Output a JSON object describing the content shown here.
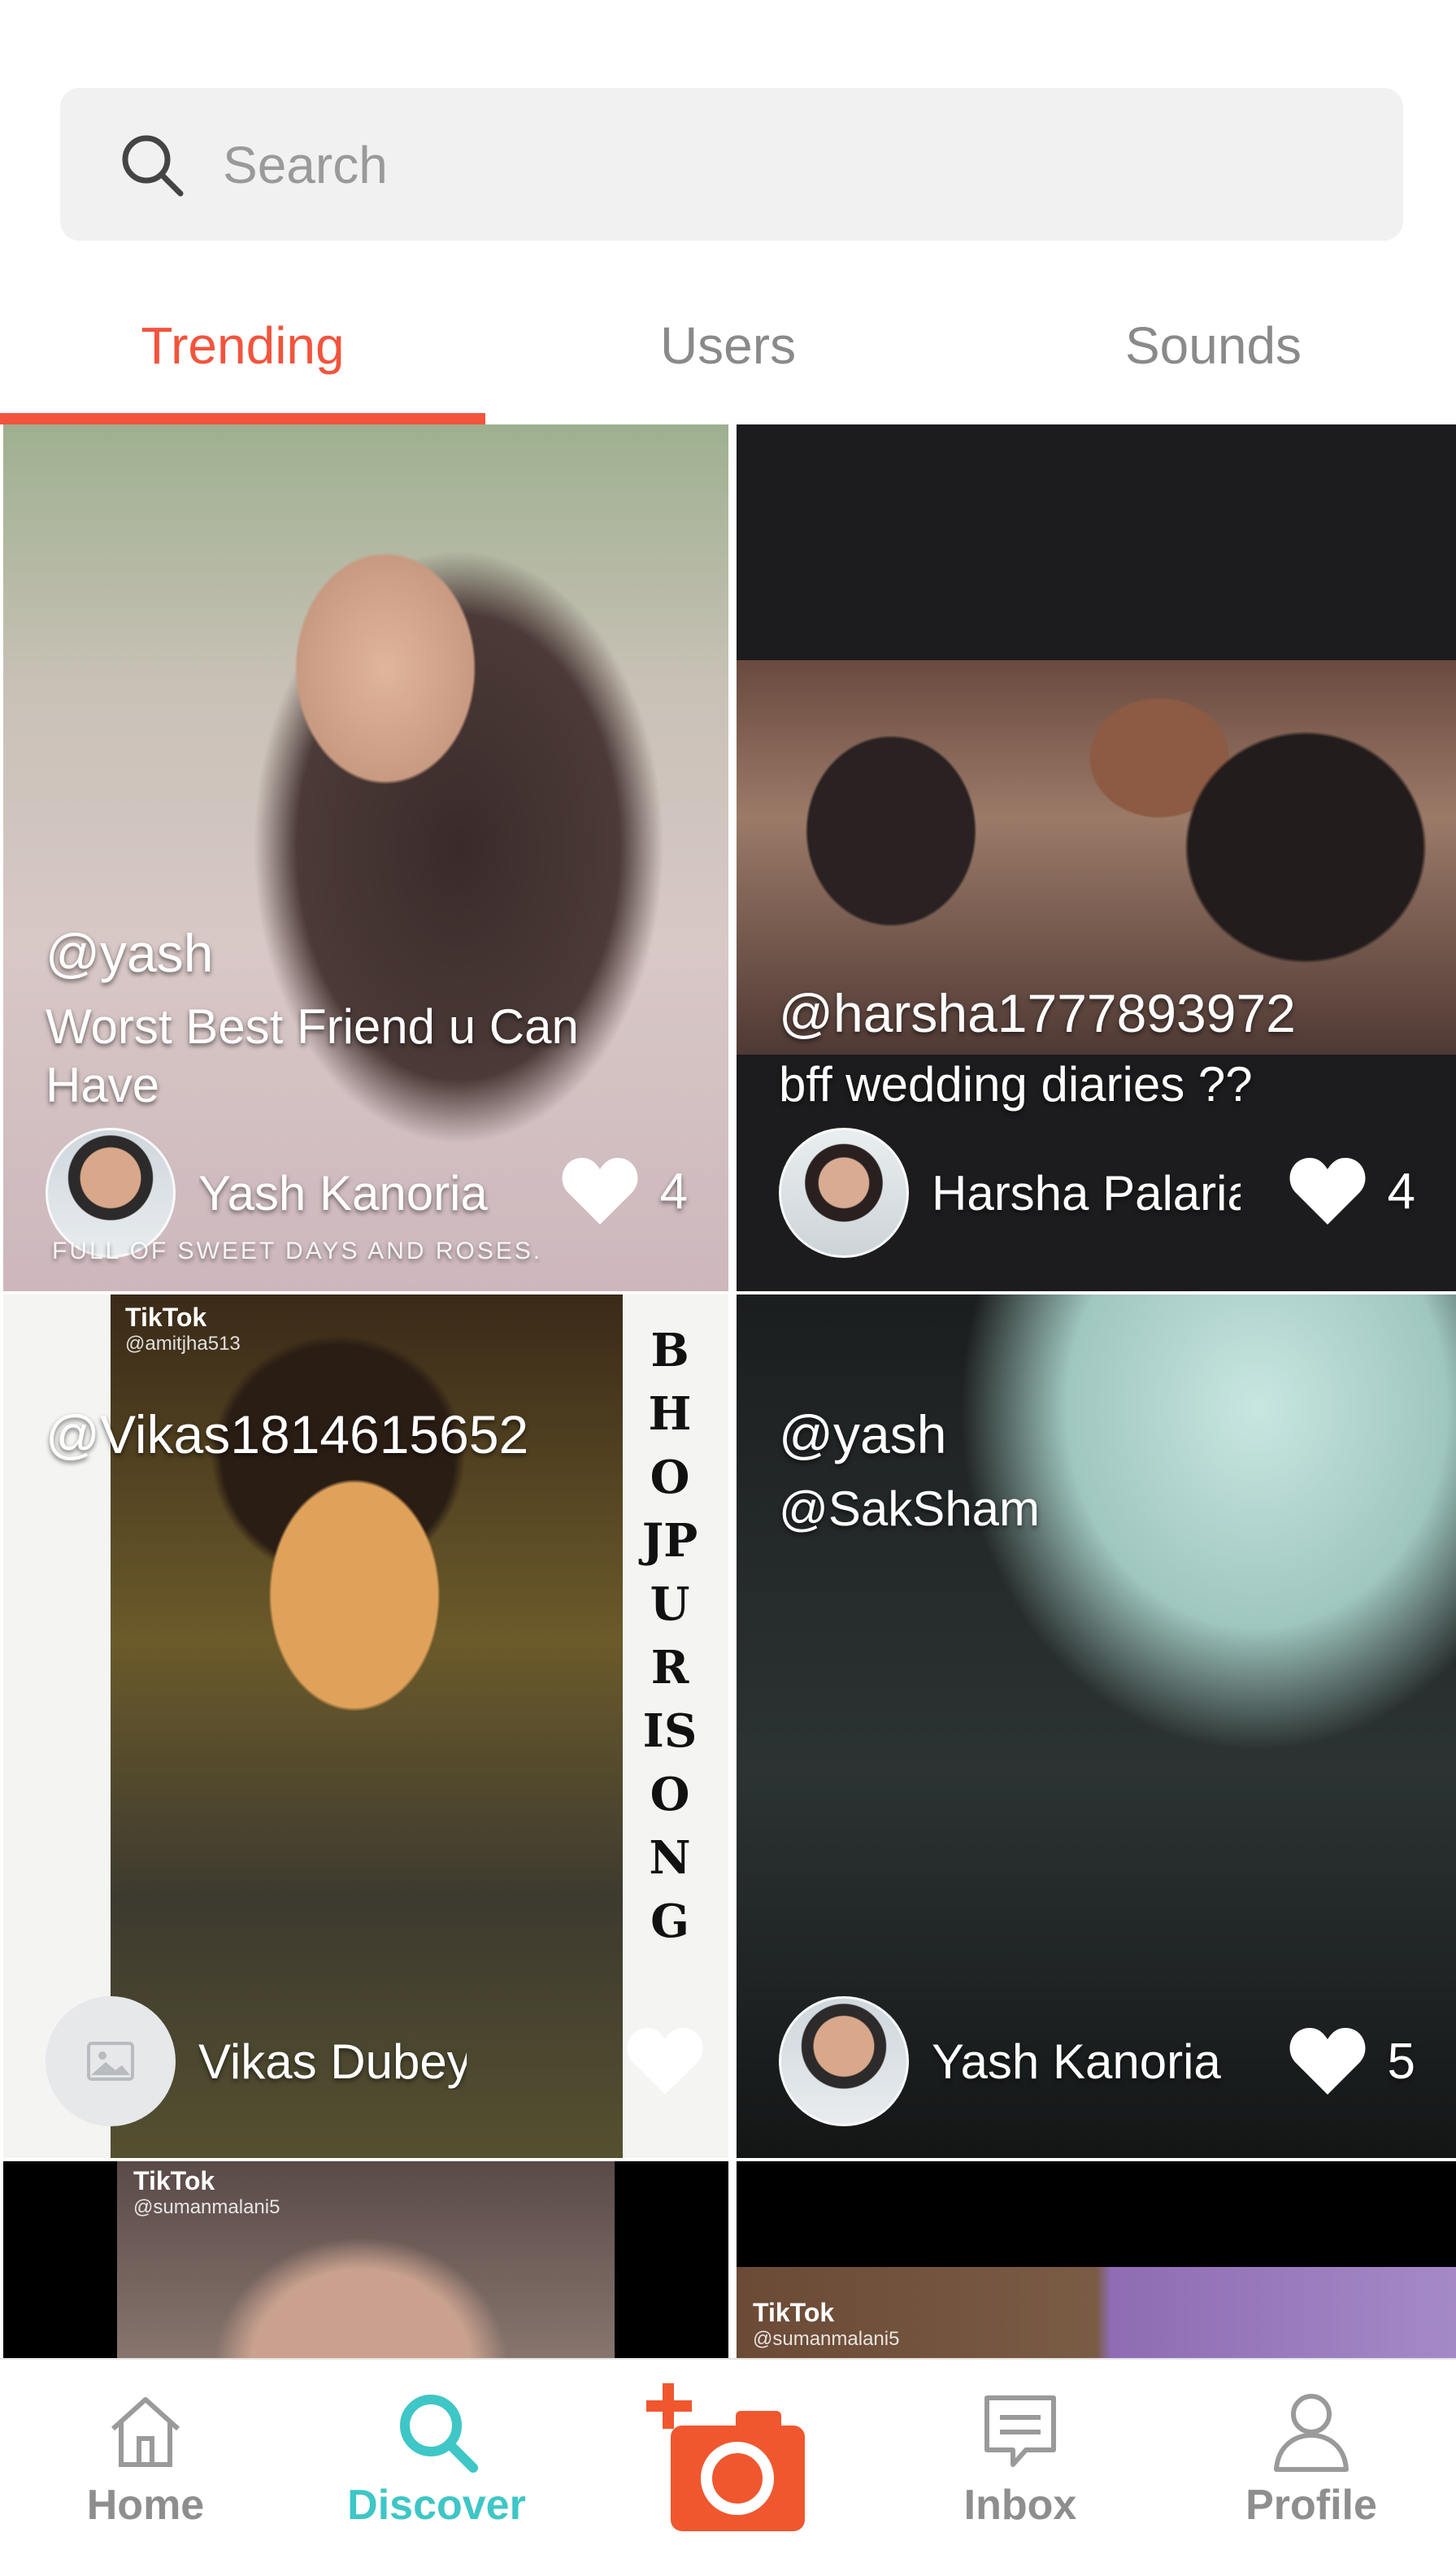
{
  "search": {
    "placeholder": "Search",
    "value": ""
  },
  "tabs": [
    {
      "label": "Trending",
      "active": true
    },
    {
      "label": "Users",
      "active": false
    },
    {
      "label": "Sounds",
      "active": false
    }
  ],
  "colors": {
    "accent": "#f2543d",
    "discover": "#3fc6c6",
    "inactive": "#8e8e8e"
  },
  "feed": [
    {
      "handle": "@yash",
      "caption": "Worst Best Friend u Can Have",
      "author": "Yash Kanoria",
      "likes": "4",
      "overlay": "FULL OF SWEET DAYS AND ROSES."
    },
    {
      "handle": "@harsha1777893972",
      "caption": "bff wedding diaries ??",
      "author": "Harsha Palaria",
      "likes": "4"
    },
    {
      "handle": "@Vikas1814615652",
      "caption": "",
      "author": "Vikas Dubey",
      "likes": "",
      "watermark": "TikTok",
      "watermark_user": "@amitjha513",
      "vertical_text": "BHOJPURISONG"
    },
    {
      "handle": "@yash",
      "caption": "@SakSham",
      "author": "Yash Kanoria",
      "likes": "5"
    },
    {
      "watermark": "TikTok",
      "watermark_user": "@sumanmalani5"
    },
    {
      "watermark": "TikTok",
      "watermark_user": "@sumanmalani5"
    }
  ],
  "bottom_nav": [
    {
      "label": "Home",
      "icon": "home-icon",
      "active": false
    },
    {
      "label": "Discover",
      "icon": "search-icon",
      "active": true
    },
    {
      "label": "",
      "icon": "camera-plus-icon",
      "active": false
    },
    {
      "label": "Inbox",
      "icon": "message-icon",
      "active": false
    },
    {
      "label": "Profile",
      "icon": "user-icon",
      "active": false
    }
  ]
}
